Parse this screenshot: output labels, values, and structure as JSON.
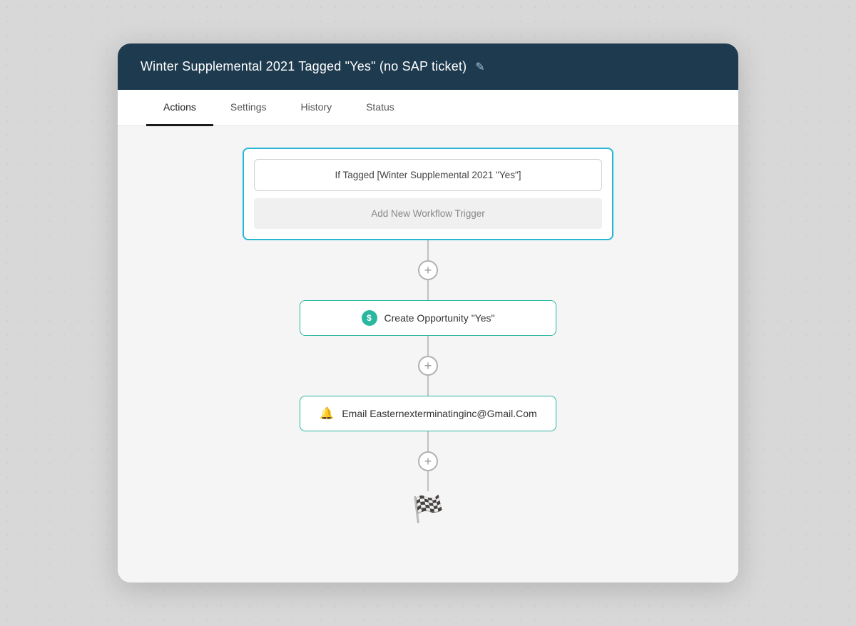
{
  "header": {
    "title": "Winter Supplemental 2021 Tagged \"Yes\" (no SAP ticket)",
    "edit_icon": "✎"
  },
  "tabs": [
    {
      "label": "Actions",
      "active": true
    },
    {
      "label": "Settings",
      "active": false
    },
    {
      "label": "History",
      "active": false
    },
    {
      "label": "Status",
      "active": false
    }
  ],
  "workflow": {
    "trigger_condition": "If Tagged [Winter Supplemental 2021 \"Yes\"]",
    "trigger_add_label": "Add New Workflow Trigger",
    "connector_plus": "+",
    "actions": [
      {
        "id": "action-1",
        "icon_type": "dollar",
        "icon_label": "$",
        "label": "Create Opportunity \"Yes\""
      },
      {
        "id": "action-2",
        "icon_type": "bell",
        "icon_label": "🔔",
        "label": "Email Easternexterminatinginc@Gmail.Com"
      }
    ],
    "finish_icon": "🏁"
  }
}
